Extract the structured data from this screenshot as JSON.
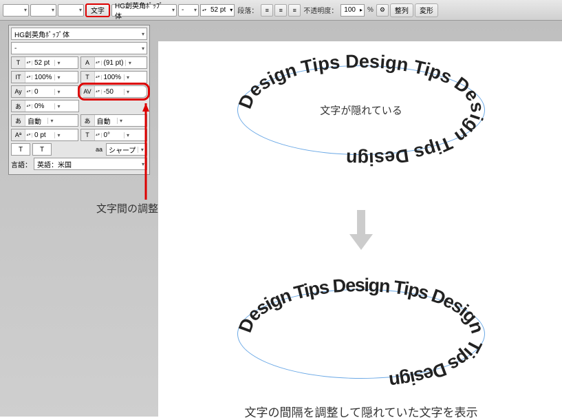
{
  "toolbar": {
    "moji_btn": "文字",
    "font_family": "HG創英角ﾎﾟｯﾌﾟ体",
    "font_style": "-",
    "font_size": "52 pt",
    "danraku_label": "段落：",
    "opacity_label": "不透明度：",
    "opacity_value": "100",
    "align_btn": "整列",
    "transform_btn": "変形"
  },
  "panel": {
    "font_family": "HG創英角ﾎﾟｯﾌﾟ体",
    "font_style": "-",
    "size": "52 pt",
    "leading": "(91 pt)",
    "vscale": "100%",
    "hscale": "100%",
    "kerning": "0",
    "tracking": "-50",
    "tsume": "0%",
    "auto1": "自動",
    "auto2": "自動",
    "baseline": "0 pt",
    "rotation": "0°",
    "t_btn": "T",
    "t2_btn": "T",
    "aa_label": "aa",
    "aa_value": "シャープ",
    "lang_label": "言語：",
    "lang_value": "英語：米国"
  },
  "canvas": {
    "hidden_text": "文字が隠れている",
    "curved_text": "Design Tips Design Tips Design Tips Design",
    "bottom_caption": "文字の間隔を調整して隠れていた文字を表示"
  },
  "annotations": {
    "kerning_adjust": "文字間の調整"
  }
}
